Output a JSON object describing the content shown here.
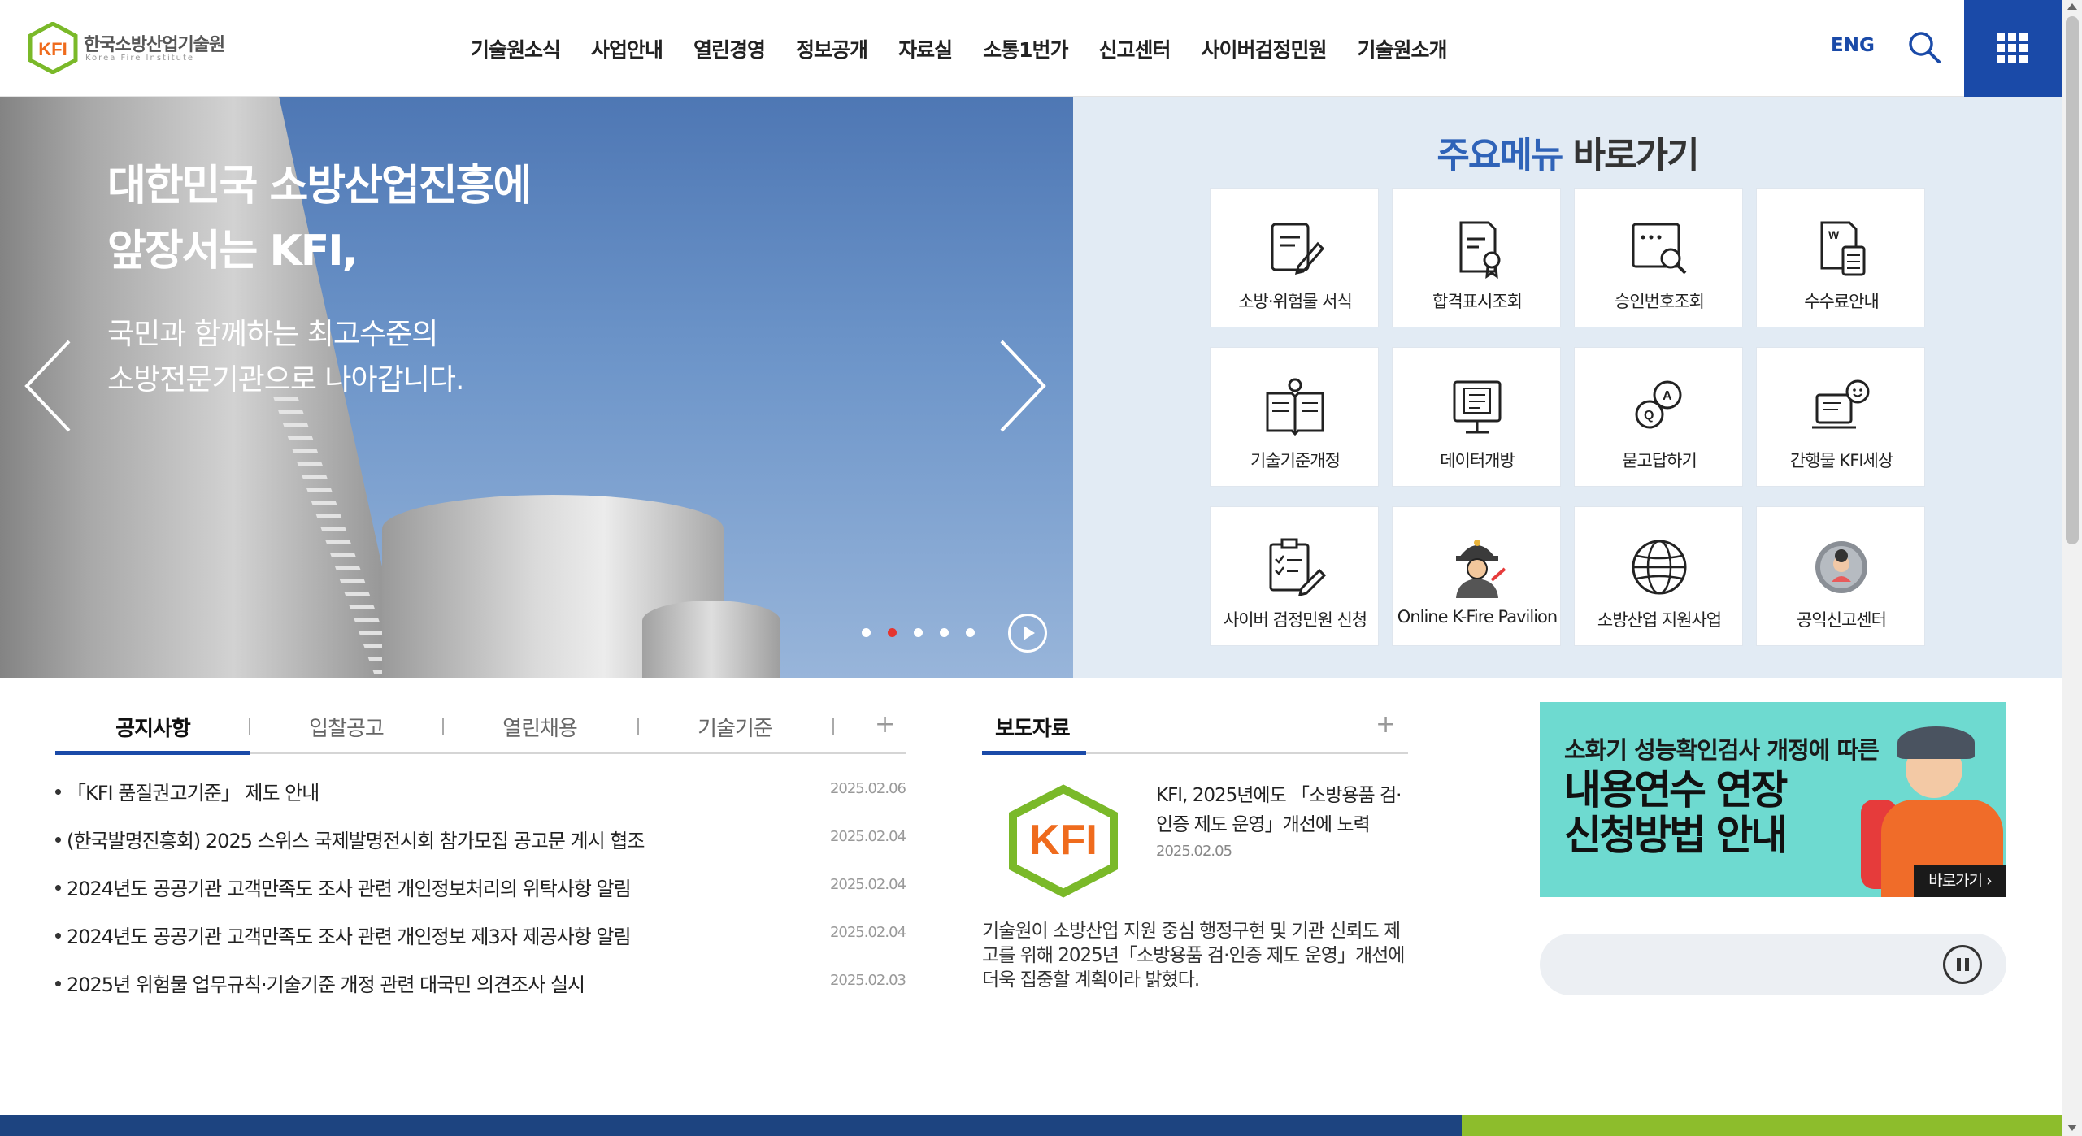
{
  "header": {
    "logo_text": "KFI",
    "org_name": "한국소방산업기술원",
    "org_name_en": "Korea Fire Institute",
    "nav": [
      "기술원소식",
      "사업안내",
      "열린경영",
      "정보공개",
      "자료실",
      "소통1번가",
      "신고센터",
      "사이버검정민원",
      "기술원소개"
    ],
    "lang": "ENG",
    "brand_color": "#1a4aa8"
  },
  "hero": {
    "title_line1": "대한민국 소방산업진흥에",
    "title_line2": "앞장서는 KFI,",
    "sub_line1": "국민과 함께하는 최고수준의",
    "sub_line2": "소방전문기관으로 나아갑니다.",
    "slide_count": 5,
    "active_slide": 2
  },
  "quick": {
    "title_highlight": "주요메뉴",
    "title_rest": " 바로가기",
    "items": [
      {
        "label": "소방·위험물 서식",
        "icon": "form-edit-icon"
      },
      {
        "label": "합격표시조회",
        "icon": "certificate-icon"
      },
      {
        "label": "승인번호조회",
        "icon": "password-search-icon"
      },
      {
        "label": "수수료안내",
        "icon": "fee-calculator-icon"
      },
      {
        "label": "기술기준개정",
        "icon": "standard-book-icon"
      },
      {
        "label": "데이터개방",
        "icon": "data-monitor-icon"
      },
      {
        "label": "묻고답하기",
        "icon": "qna-icon"
      },
      {
        "label": "간행물 KFI세상",
        "icon": "publication-icon"
      },
      {
        "label": "사이버 검정민원 신청",
        "icon": "checklist-icon"
      },
      {
        "label": "Online K-Fire Pavilion",
        "icon": "firefighter-icon"
      },
      {
        "label": "소방산업 지원사업",
        "icon": "globe-icon"
      },
      {
        "label": "공익신고센터",
        "icon": "whistleblower-icon"
      }
    ]
  },
  "board": {
    "tabs": [
      "공지사항",
      "입찰공고",
      "열린채용",
      "기술기준"
    ],
    "more": "+",
    "notices": [
      {
        "title": "「KFI 품질권고기준」 제도 안내",
        "date": "2025.02.06"
      },
      {
        "title": "(한국발명진흥회) 2025 스위스 국제발명전시회 참가모집 공고문 게시 협조",
        "date": "2025.02.04"
      },
      {
        "title": "2024년도 공공기관 고객만족도 조사 관련 개인정보처리의 위탁사항 알림",
        "date": "2025.02.04"
      },
      {
        "title": "2024년도 공공기관 고객만족도 조사 관련 개인정보 제3자 제공사항 알림",
        "date": "2025.02.04"
      },
      {
        "title": "2025년 위험물 업무규칙·기술기준 개정 관련 대국민 의견조사 실시",
        "date": "2025.02.03"
      }
    ]
  },
  "press": {
    "tab": "보도자료",
    "more": "+",
    "title": "KFI, 2025년에도 「소방용품 검·인증 제도 운영」개선에 노력",
    "date": "2025.02.05",
    "body": "기술원이 소방산업 지원 중심 행정구현 및 기관 신뢰도 제고를 위해 2025년「소방용품 검·인증 제도 운영」개선에 더욱 집중할 계획이라 밝혔다."
  },
  "banner": {
    "line1": "소화기 성능확인검사 개정에 따른",
    "line2a": "내용연수 연장",
    "line2b": "신청방법 안내",
    "go": "바로가기 ›",
    "bg_color": "#6edad0"
  }
}
